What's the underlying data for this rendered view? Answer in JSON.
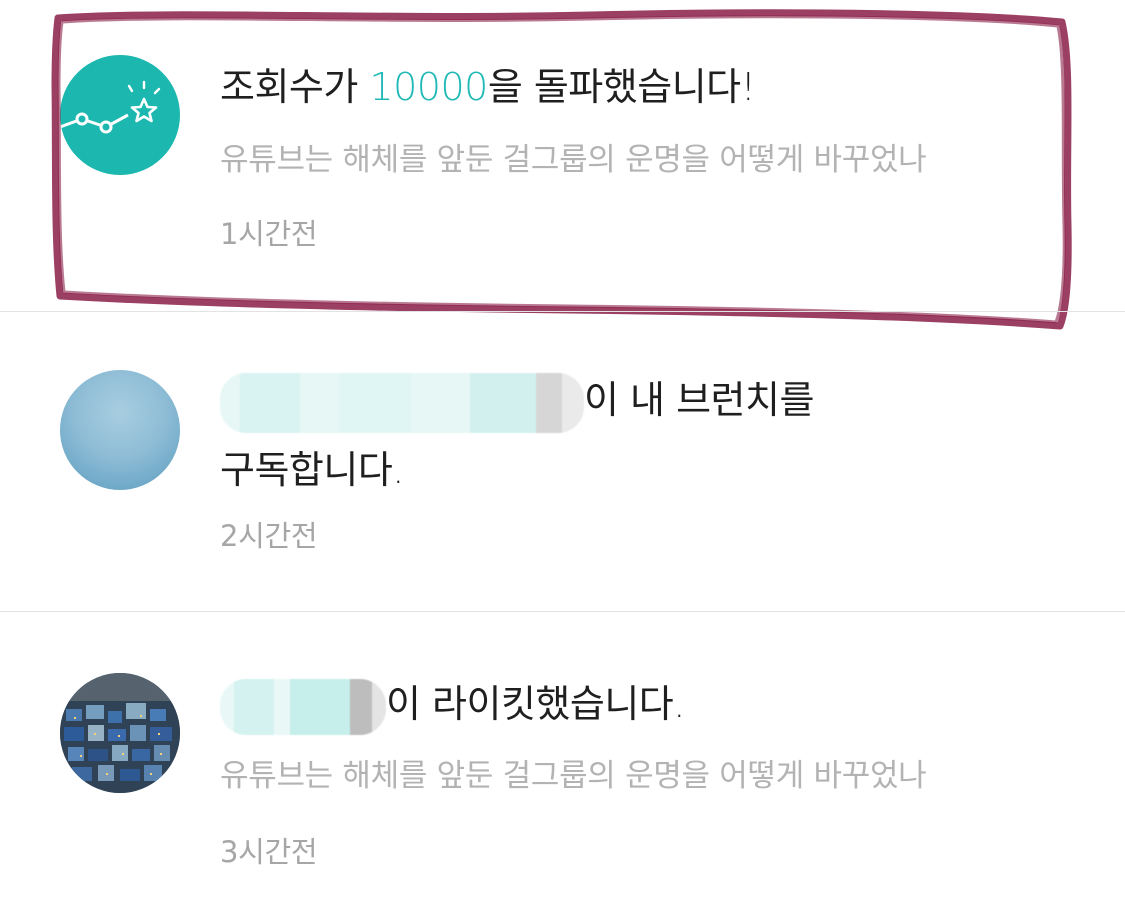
{
  "notifications": [
    {
      "title_prefix": "조회수가 ",
      "title_highlight": "10000",
      "title_suffix": "을 돌파했습니다!",
      "subtitle": "유튜브는 해체를 앞둔 걸그룹의 운명을 어떻게 바꾸었나",
      "time": "1시간전",
      "icon": "chart-star-icon",
      "highlighted": true
    },
    {
      "title_line1_suffix": "이 내 브런치를",
      "title_line2": "구독합니다.",
      "time": "2시간전",
      "icon": "user-avatar"
    },
    {
      "title_suffix": "이 라이킷했습니다.",
      "subtitle": "유튜브는 해체를 앞둔 걸그룹의 운명을 어떻게 바꾸었나",
      "time": "3시간전",
      "icon": "user-avatar"
    }
  ],
  "colors": {
    "accent": "#1fb9b6",
    "icon_bg": "#1cb8b0",
    "highlight_box": "#8a1f47",
    "muted_text": "#b3b3b3"
  }
}
